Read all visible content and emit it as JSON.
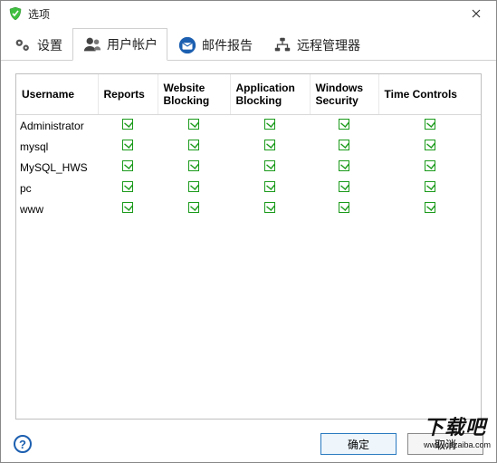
{
  "window": {
    "title": "选项"
  },
  "tabs": [
    {
      "label": "设置",
      "icon": "gears"
    },
    {
      "label": "用户帐户",
      "icon": "users"
    },
    {
      "label": "邮件报告",
      "icon": "mail"
    },
    {
      "label": "远程管理器",
      "icon": "network"
    }
  ],
  "active_tab_index": 1,
  "table": {
    "columns": [
      "Username",
      "Reports",
      "Website Blocking",
      "Application Blocking",
      "Windows Security",
      "Time Controls"
    ],
    "rows": [
      {
        "username": "Administrator",
        "checks": [
          true,
          true,
          true,
          true,
          true
        ]
      },
      {
        "username": "mysql",
        "checks": [
          true,
          true,
          true,
          true,
          true
        ]
      },
      {
        "username": "MySQL_HWS",
        "checks": [
          true,
          true,
          true,
          true,
          true
        ]
      },
      {
        "username": "pc",
        "checks": [
          true,
          true,
          true,
          true,
          true
        ]
      },
      {
        "username": "www",
        "checks": [
          true,
          true,
          true,
          true,
          true
        ]
      }
    ]
  },
  "footer": {
    "ok_label": "确定",
    "cancel_label": "取消"
  },
  "watermark": {
    "main": "下载吧",
    "sub": "www.xiazaiba.com"
  }
}
